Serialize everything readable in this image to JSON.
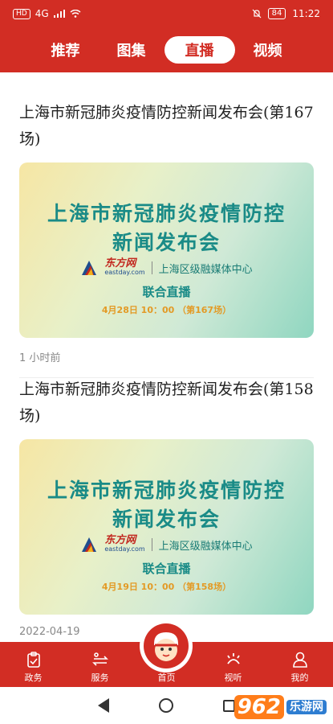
{
  "statusbar": {
    "left_badge": "HD",
    "signal": "4G",
    "time": "11:22",
    "battery": "84"
  },
  "tabs": [
    {
      "label": "推荐"
    },
    {
      "label": "图集"
    },
    {
      "label": "直播"
    },
    {
      "label": "视频"
    }
  ],
  "active_tab": "直播",
  "items": [
    {
      "title": "上海市新冠肺炎疫情防控新闻发布会(第167场)",
      "banner_line1": "上海市新冠肺炎疫情防控",
      "banner_line2": "新闻发布会",
      "logo_cn": "东方网",
      "logo_en": "eastday.com",
      "media": "上海区级融媒体中心",
      "live": "联合直播",
      "time": "4月28日 10：00 （第167场）",
      "meta": "1 小时前"
    },
    {
      "title": "上海市新冠肺炎疫情防控新闻发布会(第158场)",
      "banner_line1": "上海市新冠肺炎疫情防控",
      "banner_line2": "新闻发布会",
      "logo_cn": "东方网",
      "logo_en": "eastday.com",
      "media": "上海区级融媒体中心",
      "live": "联合直播",
      "time": "4月19日 10：00 （第158场）",
      "meta": "2022-04-19"
    }
  ],
  "bottomnav": [
    {
      "label": "政务",
      "icon": "clipboard-icon"
    },
    {
      "label": "服务",
      "icon": "service-icon"
    },
    {
      "label": "首页",
      "icon": "home-mascot-icon"
    },
    {
      "label": "视听",
      "icon": "broadcast-icon"
    },
    {
      "label": "我的",
      "icon": "user-icon"
    }
  ],
  "watermark": {
    "num": "962",
    "text": "乐游网"
  },
  "colors": {
    "brand_red": "#d22d24",
    "banner_teal": "#1a8b87"
  }
}
